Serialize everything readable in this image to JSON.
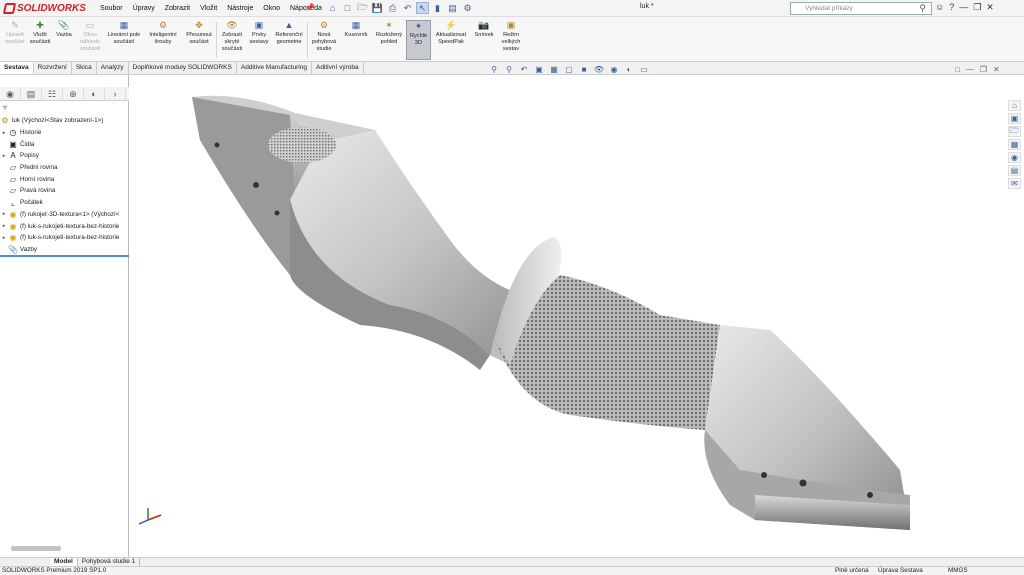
{
  "app": {
    "brand": "SOLIDWORKS",
    "doc_title": "luk *"
  },
  "menu": [
    "Soubor",
    "Úpravy",
    "Zobrazit",
    "Vložit",
    "Nástroje",
    "Okno",
    "Nápověda"
  ],
  "search": {
    "placeholder": "Vyhledat příkazy"
  },
  "ribbon": {
    "upravit": "Upravit součást",
    "vlozit": "Vložit součásti",
    "vazba": "Vazba",
    "okno": "Okno náhledu součásti",
    "linearni": "Lineární pole součástí",
    "srouby": "Inteligentní šrouby",
    "presunout": "Přesunout součást",
    "zobrazit": "Zobrazit skryté součásti",
    "prvky": "Prvky sestavy",
    "ref": "Referenční geometrie",
    "nova": "Nová pohybová studie",
    "kusovnik": "Kusovník",
    "rozlozeny": "Rozložený pohled",
    "rychle": "Rychlé 3D",
    "speedpak": "Aktualizovat SpeedPak",
    "snimek": "Snímek",
    "rezim": "Režim velkých sestav"
  },
  "tabs": [
    "Sestava",
    "Rozvržení",
    "Skica",
    "Analýzy",
    "Doplňkové moduly SOLIDWORKS",
    "Additive Manufacturing",
    "Aditivní výroba"
  ],
  "tree": {
    "root": "luk  (Výchozí<Stav zobrazení-1>)",
    "items": [
      "Historie",
      "Čidla",
      "Popisy",
      "Přední rovina",
      "Horní rovina",
      "Pravá rovina",
      "Počátek",
      "(f) rukojeť-3D-textura<1> (Výchozí<",
      "(f) luk-s-rukojeti-textura-bez-historie",
      "(f) luk-s-rukojeti-textura-bez-historie",
      "Vazby"
    ]
  },
  "bottom_tabs": [
    "Model",
    "Pohybová studie 1"
  ],
  "status": {
    "version": "SOLIDWORKS Premium 2019 SP1.0",
    "defined": "Plně určená",
    "mode": "Úprava Sestava",
    "units": "MMGS"
  },
  "colors": {
    "accent": "#d21f28",
    "selection": "#4a90d9"
  }
}
